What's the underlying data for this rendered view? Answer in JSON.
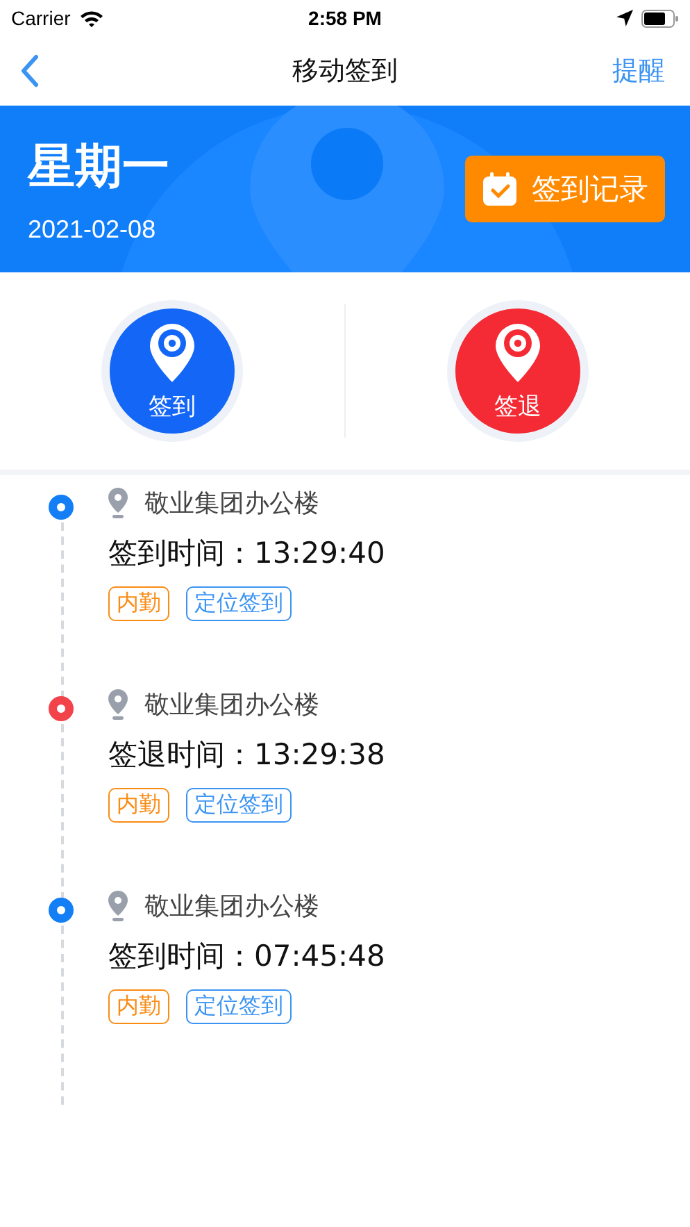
{
  "status_bar": {
    "carrier": "Carrier",
    "time": "2:58 PM"
  },
  "nav": {
    "title": "移动签到",
    "action": "提醒"
  },
  "banner": {
    "weekday": "星期一",
    "date": "2021-02-08",
    "button": "签到记录"
  },
  "actions": [
    {
      "label": "签到",
      "color": "#1366f6"
    },
    {
      "label": "签退",
      "color": "#f42a35"
    }
  ],
  "records": [
    {
      "place": "敬业集团办公楼",
      "time": "签到时间：13:29:40",
      "color": "#137ef5",
      "tags": [
        {
          "label": "内勤",
          "color": "#fa8c16"
        },
        {
          "label": "定位签到",
          "color": "#3c94f2"
        }
      ]
    },
    {
      "place": "敬业集团办公楼",
      "time": "签退时间：13:29:38",
      "color": "#f2434b",
      "tags": [
        {
          "label": "内勤",
          "color": "#fa8c16"
        },
        {
          "label": "定位签到",
          "color": "#3c94f2"
        }
      ]
    },
    {
      "place": "敬业集团办公楼",
      "time": "签到时间：07:45:48",
      "color": "#137ef5",
      "tags": [
        {
          "label": "内勤",
          "color": "#fa8c16"
        },
        {
          "label": "定位签到",
          "color": "#3c94f2"
        }
      ]
    }
  ]
}
